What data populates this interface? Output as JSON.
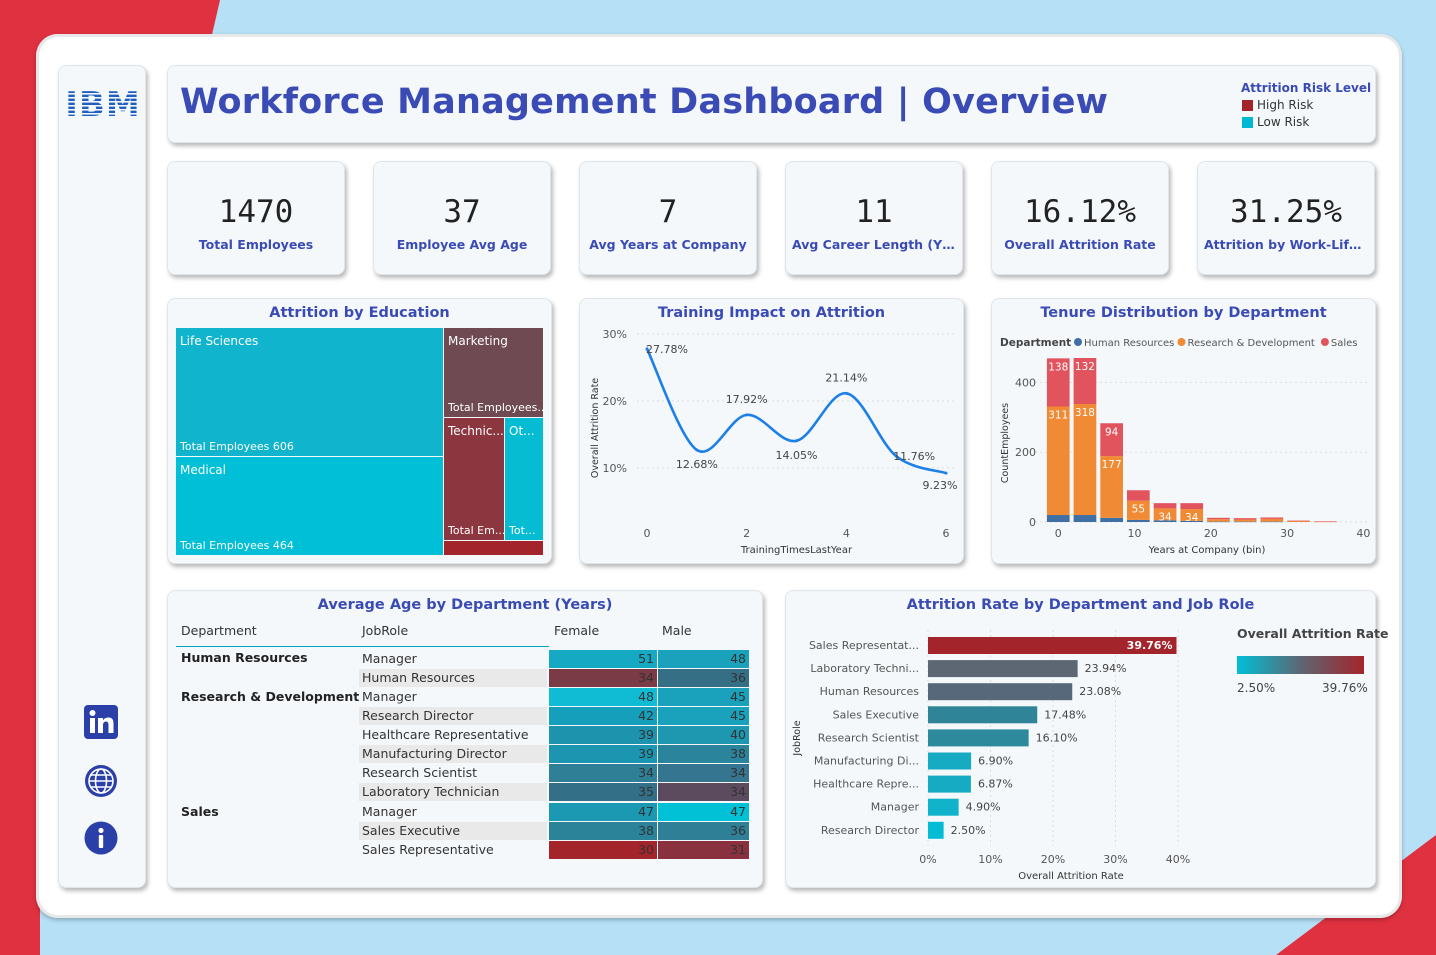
{
  "header": {
    "logo_text": "IBM",
    "title": "Workforce Management Dashboard | Overview",
    "legend_title": "Attrition Risk Level",
    "legend_items": [
      {
        "label": "High Risk",
        "color": "#a3252b"
      },
      {
        "label": "Low Risk",
        "color": "#00b8d1"
      }
    ]
  },
  "sidebar": {
    "icons": [
      "linkedin-icon",
      "globe-icon",
      "info-icon"
    ]
  },
  "kpis": [
    {
      "value": "1470",
      "label": "Total Employees"
    },
    {
      "value": "37",
      "label": "Employee Avg Age"
    },
    {
      "value": "7",
      "label": "Avg Years at Company"
    },
    {
      "value": "11",
      "label": "Avg Career Length (Yrs.)"
    },
    {
      "value": "16.12%",
      "label": "Overall Attrition Rate"
    },
    {
      "value": "31.25%",
      "label": "Attrition by Work-Life Bal..."
    }
  ],
  "education": {
    "title": "Attrition by Education",
    "cells": [
      {
        "label": "Life Sciences",
        "sub": "Total Employees 606"
      },
      {
        "label": "Medical",
        "sub": "Total Employees 464"
      },
      {
        "label": "Marketing",
        "sub": "Total Employees..."
      },
      {
        "label": "Technic...",
        "sub": "Total Em..."
      },
      {
        "label": "Ot...",
        "sub": "Tot..."
      }
    ]
  },
  "training": {
    "title": "Training Impact on Attrition"
  },
  "tenure": {
    "title": "Tenure Distribution by Department",
    "legend_label": "Department"
  },
  "age_table": {
    "title": "Average Age by Department (Years)",
    "headers": [
      "Department",
      "JobRole",
      "Female",
      "Male"
    ],
    "depts": [
      "Human Resources",
      "Research & Development",
      "Sales"
    ],
    "rows": [
      {
        "role": "Manager",
        "female": "51",
        "male": "48"
      },
      {
        "role": "Human Resources",
        "female": "34",
        "male": "36"
      },
      {
        "role": "Manager",
        "female": "48",
        "male": "45"
      },
      {
        "role": "Research Director",
        "female": "42",
        "male": "45"
      },
      {
        "role": "Healthcare Representative",
        "female": "39",
        "male": "40"
      },
      {
        "role": "Manufacturing Director",
        "female": "39",
        "male": "38"
      },
      {
        "role": "Research Scientist",
        "female": "34",
        "male": "34"
      },
      {
        "role": "Laboratory Technician",
        "female": "35",
        "male": "34"
      },
      {
        "role": "Manager",
        "female": "47",
        "male": "47"
      },
      {
        "role": "Sales Executive",
        "female": "38",
        "male": "36"
      },
      {
        "role": "Sales Representative",
        "female": "30",
        "male": "31"
      }
    ],
    "female_colors": [
      "#16a9c4",
      "#7a3a46",
      "#10bcd4",
      "#169fba",
      "#1e93ad",
      "#1c96b0",
      "#2f7f96",
      "#336f86",
      "#1b98b2",
      "#2a8399",
      "#a3252b"
    ],
    "male_colors": [
      "#1aa2bd",
      "#356f86",
      "#1aa2bd",
      "#1aa2bd",
      "#1e97b1",
      "#2a859c",
      "#357590",
      "#5c4b5f",
      "#00c1d6",
      "#2f7f96",
      "#8a3140"
    ]
  },
  "attrition_role": {
    "title": "Attrition Rate by Department and Job Role",
    "legend_title": "Overall Attrition Rate",
    "legend_min": "2.50%",
    "legend_max": "39.76%"
  },
  "chart_data": [
    {
      "type": "line",
      "title": "Training Impact on Attrition",
      "xlabel": "TrainingTimesLastYear",
      "ylabel": "Overall Attrition Rate",
      "x": [
        0,
        1,
        2,
        3,
        4,
        5,
        6
      ],
      "y": [
        27.78,
        12.68,
        17.92,
        14.05,
        21.14,
        11.76,
        9.23
      ],
      "labels": [
        "27.78%",
        "12.68%",
        "17.92%",
        "14.05%",
        "21.14%",
        "11.76%",
        "9.23%"
      ],
      "xticks": [
        "0",
        "2",
        "4",
        "6"
      ],
      "yticks": [
        "10%",
        "20%",
        "30%"
      ],
      "ylim": [
        7,
        30
      ]
    },
    {
      "type": "bar",
      "title": "Tenure Distribution by Department",
      "xlabel": "Years at Company (bin)",
      "ylabel": "CountEmployees",
      "xticks": [
        "0",
        "10",
        "20",
        "30",
        "40"
      ],
      "yticks": [
        "0",
        "200",
        "400"
      ],
      "ylim": [
        0,
        470
      ],
      "xlim": [
        -2,
        41
      ],
      "bin_starts": [
        0,
        3.5,
        7,
        10.5,
        14,
        17.5,
        21,
        24.5,
        28,
        31.5,
        35
      ],
      "series": [
        {
          "name": "Human Resources",
          "color": "#3f6fa3",
          "values": [
            20,
            20,
            12,
            6,
            5,
            3,
            1,
            1,
            1,
            0,
            0
          ]
        },
        {
          "name": "Research & Development",
          "color": "#f08a34",
          "values": [
            311,
            318,
            177,
            55,
            34,
            34,
            7,
            6,
            8,
            3,
            1
          ]
        },
        {
          "name": "Sales",
          "color": "#e2545d",
          "values": [
            138,
            132,
            94,
            30,
            15,
            17,
            4,
            4,
            4,
            1,
            1
          ]
        }
      ],
      "bar_labels": [
        {
          "bin": 0,
          "series": 1,
          "text": "311"
        },
        {
          "bin": 1,
          "series": 1,
          "text": "318"
        },
        {
          "bin": 2,
          "series": 1,
          "text": "177"
        },
        {
          "bin": 3,
          "series": 1,
          "text": "55"
        },
        {
          "bin": 4,
          "series": 1,
          "text": "34"
        },
        {
          "bin": 5,
          "series": 1,
          "text": "34"
        },
        {
          "bin": 0,
          "series": 2,
          "text": "138"
        },
        {
          "bin": 1,
          "series": 2,
          "text": "132"
        },
        {
          "bin": 2,
          "series": 2,
          "text": "94"
        }
      ]
    },
    {
      "type": "bar",
      "orientation": "horizontal",
      "title": "Attrition Rate by Department and Job Role",
      "xlabel": "Overall Attrition Rate",
      "ylabel": "JobRole",
      "categories": [
        "Sales Representat...",
        "Laboratory Techni...",
        "Human Resources",
        "Sales Executive",
        "Research Scientist",
        "Manufacturing Di...",
        "Healthcare Repre...",
        "Manager",
        "Research Director"
      ],
      "values": [
        39.76,
        23.94,
        23.08,
        17.48,
        16.1,
        6.9,
        6.87,
        4.9,
        2.5
      ],
      "labels": [
        "39.76%",
        "23.94%",
        "23.08%",
        "17.48%",
        "16.10%",
        "6.90%",
        "6.87%",
        "4.90%",
        "2.50%"
      ],
      "colors": [
        "#a3252b",
        "#5d6673",
        "#57687a",
        "#2f8597",
        "#2c8a9c",
        "#16aac3",
        "#16aac3",
        "#11b3ca",
        "#04bdd4"
      ],
      "xticks": [
        "0%",
        "10%",
        "20%",
        "30%",
        "40%"
      ],
      "xlim": [
        0,
        40
      ]
    },
    {
      "type": "treemap",
      "title": "Attrition by Education",
      "categories": [
        "Life Sciences",
        "Medical",
        "Marketing",
        "Technical Degree",
        "Other"
      ],
      "values": [
        606,
        464,
        null,
        null,
        null
      ]
    }
  ]
}
